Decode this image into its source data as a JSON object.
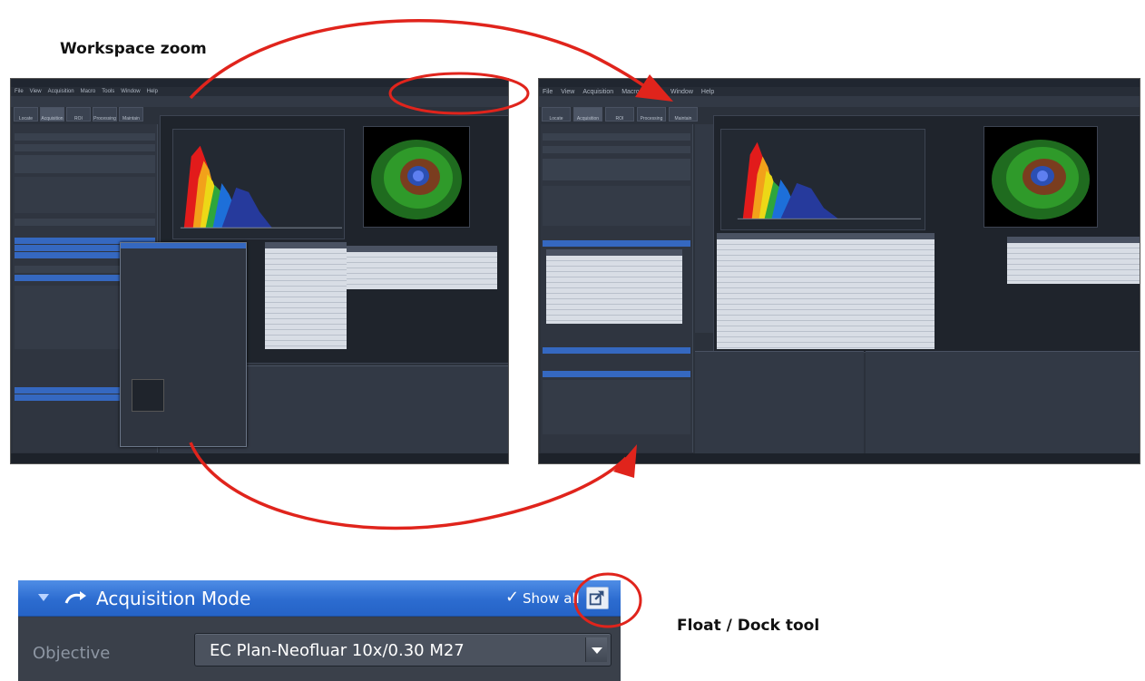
{
  "captions": {
    "workspace_zoom": "Workspace zoom",
    "float_dock": "Float / Dock tool"
  },
  "screenshot_left": {
    "menu_items": [
      "File",
      "View",
      "Acquisition",
      "Macro",
      "Tools",
      "Window",
      "Help"
    ],
    "tabs": [
      "Locate",
      "Acquisition",
      "ROI",
      "Processing",
      "Maintain"
    ]
  },
  "screenshot_right": {
    "menu_items": [
      "File",
      "View",
      "Acquisition",
      "Macro",
      "Tools",
      "Window",
      "Help"
    ],
    "tabs": [
      "Locate",
      "Acquisition",
      "ROI",
      "Processing",
      "Maintain"
    ]
  },
  "zoomed_tool": {
    "title": "Acquisition Mode",
    "show_all_check": "✓",
    "show_all_label": "Show all",
    "objective_label": "Objective",
    "objective_value": "EC Plan-Neofluar 10x/0.30 M27"
  },
  "colors": {
    "header_blue": "#2c6cd0",
    "annotation_red": "#e0241c",
    "panel_dark": "#373d47"
  }
}
